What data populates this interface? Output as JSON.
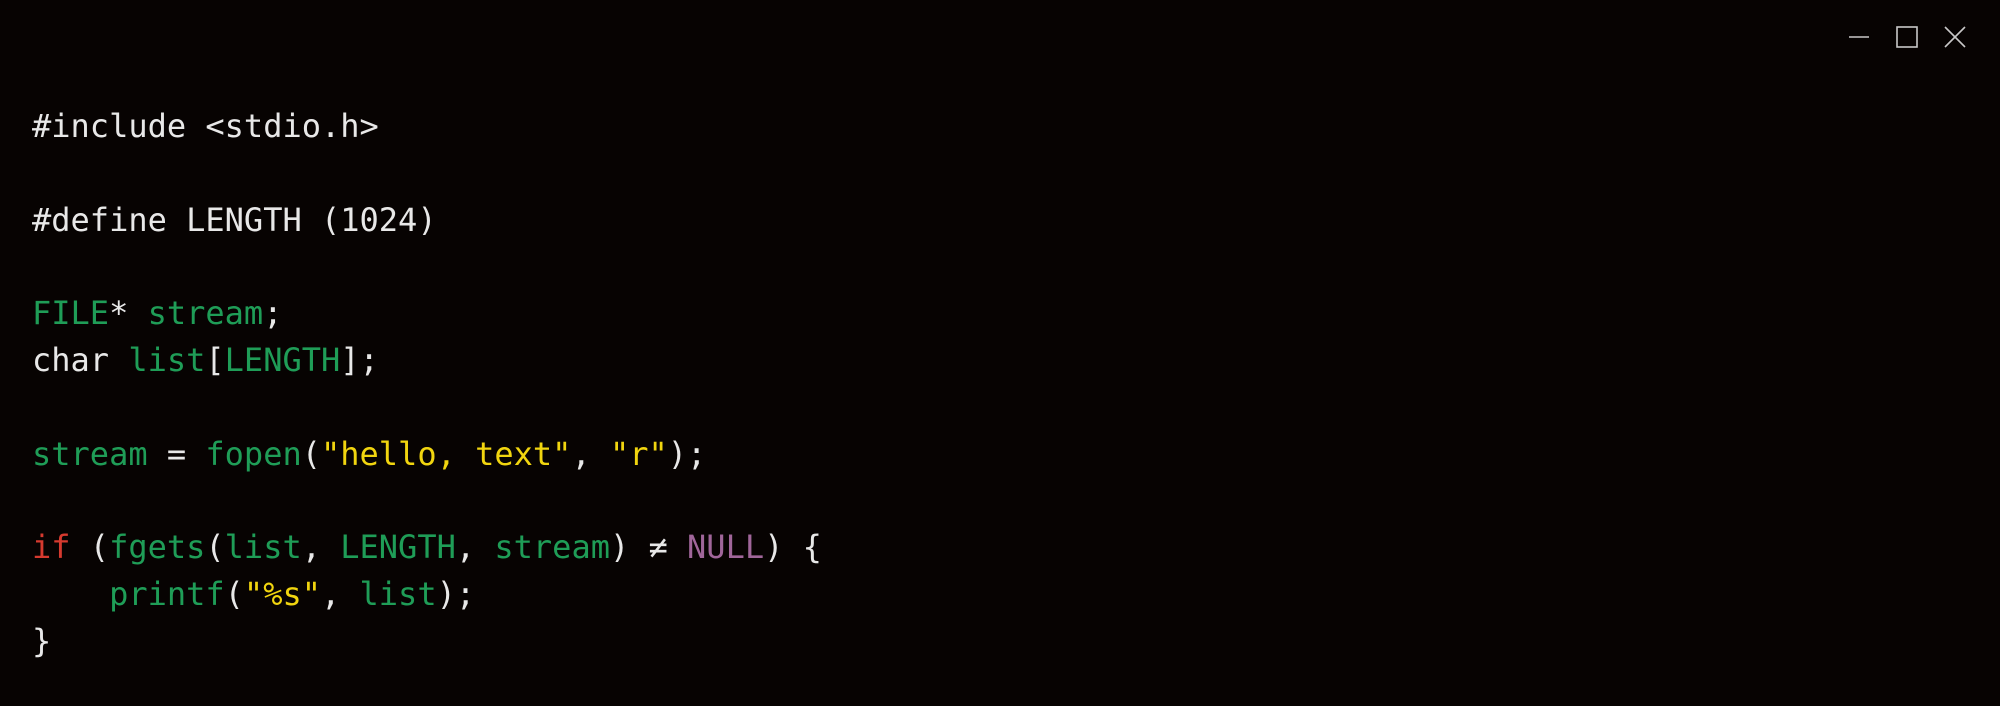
{
  "window": {
    "controls": [
      "minimize-icon",
      "maximize-icon",
      "close-icon"
    ]
  },
  "colors": {
    "background": "#070302",
    "plain": "#e8e8e8",
    "identifier": "#1f9d57",
    "string": "#f1d50f",
    "keyword": "#d63a2f",
    "constant": "#a0669a"
  },
  "code": {
    "lines": [
      [
        {
          "t": "#include <stdio.h>",
          "c": "plain"
        }
      ],
      [],
      [
        {
          "t": "#define LENGTH (1024)",
          "c": "plain"
        }
      ],
      [],
      [
        {
          "t": "FILE",
          "c": "identifier"
        },
        {
          "t": "* ",
          "c": "plain"
        },
        {
          "t": "stream",
          "c": "identifier"
        },
        {
          "t": ";",
          "c": "plain"
        }
      ],
      [
        {
          "t": "char ",
          "c": "plain"
        },
        {
          "t": "list",
          "c": "identifier"
        },
        {
          "t": "[",
          "c": "plain"
        },
        {
          "t": "LENGTH",
          "c": "identifier"
        },
        {
          "t": "];",
          "c": "plain"
        }
      ],
      [],
      [
        {
          "t": "stream",
          "c": "identifier"
        },
        {
          "t": " = ",
          "c": "plain"
        },
        {
          "t": "fopen",
          "c": "identifier"
        },
        {
          "t": "(",
          "c": "plain"
        },
        {
          "t": "\"hello, text\"",
          "c": "string"
        },
        {
          "t": ", ",
          "c": "plain"
        },
        {
          "t": "\"r\"",
          "c": "string"
        },
        {
          "t": ");",
          "c": "plain"
        }
      ],
      [],
      [
        {
          "t": "if",
          "c": "keyword"
        },
        {
          "t": " (",
          "c": "plain"
        },
        {
          "t": "fgets",
          "c": "identifier"
        },
        {
          "t": "(",
          "c": "plain"
        },
        {
          "t": "list",
          "c": "identifier"
        },
        {
          "t": ", ",
          "c": "plain"
        },
        {
          "t": "LENGTH",
          "c": "identifier"
        },
        {
          "t": ", ",
          "c": "plain"
        },
        {
          "t": "stream",
          "c": "identifier"
        },
        {
          "t": ") ≠ ",
          "c": "plain"
        },
        {
          "t": "NULL",
          "c": "constant"
        },
        {
          "t": ") {",
          "c": "plain"
        }
      ],
      [
        {
          "t": "    ",
          "c": "plain"
        },
        {
          "t": "printf",
          "c": "identifier"
        },
        {
          "t": "(",
          "c": "plain"
        },
        {
          "t": "\"%s\"",
          "c": "string"
        },
        {
          "t": ", ",
          "c": "plain"
        },
        {
          "t": "list",
          "c": "identifier"
        },
        {
          "t": ");",
          "c": "plain"
        }
      ],
      [
        {
          "t": "}",
          "c": "plain"
        }
      ]
    ]
  }
}
